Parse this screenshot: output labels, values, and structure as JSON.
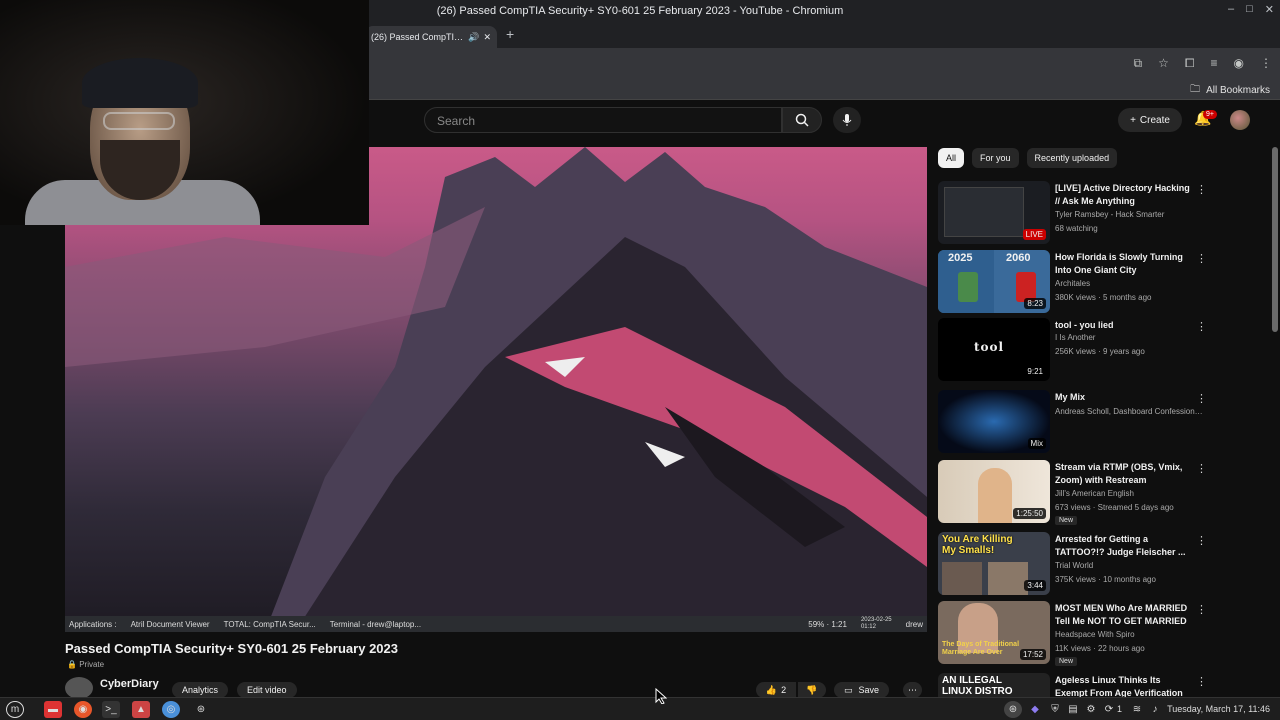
{
  "window": {
    "title": "(26) Passed CompTIA Security+ SY0-601 25 February 2023 - YouTube - Chromium",
    "tab_title": "(26) Passed CompTIA Secu",
    "bookmarks_label": "All Bookmarks"
  },
  "youtube": {
    "search_placeholder": "Search",
    "create_label": "Create",
    "notification_badge": "9+",
    "filters": [
      "All",
      "For you",
      "Recently uploaded"
    ],
    "video": {
      "title": "Passed CompTIA Security+ SY0-601 25 February 2023",
      "privacy": "Private",
      "channel": "CyberDiary",
      "analytics_label": "Analytics",
      "edit_label": "Edit video",
      "likes": "2",
      "save_label": "Save"
    },
    "recommendations": [
      {
        "title": "[LIVE] Active Directory Hacking // Ask Me Anything",
        "channel": "Tyler Ramsbey - Hack Smarter",
        "meta": "68 watching",
        "badge": "LIVE",
        "new": ""
      },
      {
        "title": "How Florida is Slowly Turning Into One Giant City",
        "channel": "Architales",
        "meta": "380K views · 5 months ago",
        "badge": "8:23",
        "new": ""
      },
      {
        "title": "tool - you lied",
        "channel": "I Is Another",
        "meta": "256K views · 9 years ago",
        "badge": "9:21",
        "new": ""
      },
      {
        "title": "My Mix",
        "channel": "Andreas Scholl, Dashboard Confessional...",
        "meta": "",
        "badge": "Mix",
        "new": ""
      },
      {
        "title": "Stream via RTMP (OBS, Vmix, Zoom) with Restream",
        "channel": "Jill's American English",
        "meta": "673 views · Streamed 5 days ago",
        "badge": "1:25:50",
        "new": "New"
      },
      {
        "title": "Arrested for Getting a TATTOO?!? Judge Fleischer ...",
        "channel": "Trial World",
        "meta": "375K views · 10 months ago",
        "badge": "3:44",
        "new": ""
      },
      {
        "title": "MOST MEN Who Are MARRIED Tell Me NOT TO GET MARRIED ...",
        "channel": "Headspace With Spiro",
        "meta": "11K views · 22 hours ago",
        "badge": "17:52",
        "new": "New"
      },
      {
        "title": "Ageless Linux Thinks Its Exempt From Age Verification",
        "channel": "",
        "meta": "",
        "badge": "",
        "new": ""
      }
    ],
    "thumb_text": {
      "florida_left": "2025",
      "florida_right": "2060",
      "tool": "tool",
      "killing": "You Are Killing My Smalls!",
      "married": "The Days of Traditional Marriage Are Over",
      "linux": "AN ILLEGAL LINUX DISTRO"
    }
  },
  "inner_taskbar": {
    "apps": "Applications :",
    "viewer": "Atril Document Viewer",
    "total": "TOTAL: CompTIA Secur...",
    "terminal": "Terminal - drew@laptop...",
    "battery": "59% · 1:21",
    "date": "2023-02-25",
    "time": "01:12",
    "user": "drew"
  },
  "os_taskbar": {
    "clock": "Tuesday, March 17, 11:46",
    "update_badge": "1"
  }
}
